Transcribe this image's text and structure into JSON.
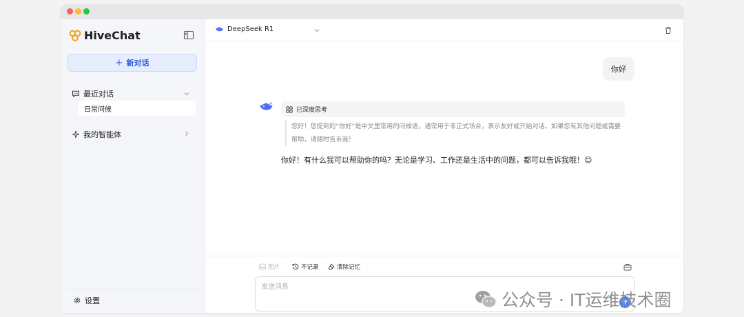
{
  "app": {
    "name": "HiveChat"
  },
  "sidebar": {
    "new_chat_label": "新对话",
    "recent_label": "最近对话",
    "recent_items": [
      "日常问候"
    ],
    "agents_label": "我的智能体",
    "settings_label": "设置"
  },
  "header": {
    "model_name": "DeepSeek R1"
  },
  "conversation": {
    "user_message": "你好",
    "thinking_label": "已深度思考",
    "thinking_text": "您好！您提到的“你好”是中文里常用的问候语，通常用于非正式场合，表示友好或开始对话。如果您有其他问题或需要帮助，请随时告诉我！",
    "answer_text": "你好！有什么我可以帮助你的吗？无论是学习、工作还是生活中的问题，都可以告诉我哦！😊"
  },
  "composer": {
    "image_label": "图片",
    "no_record_label": "不记录",
    "clear_memory_label": "清除记忆",
    "placeholder": "发送消息"
  },
  "watermark": {
    "text": "公众号 · IT运维技术圈"
  },
  "colors": {
    "accent": "#2f5fd8",
    "accent_bg": "#e6edfc",
    "send_button": "#4a7ff5",
    "logo": "#f5a623"
  },
  "icons": {
    "logo": "honeycomb-logo-icon",
    "sidebar_toggle": "sidebar-toggle-icon",
    "recent": "chat-bubble-icon",
    "agents": "sparkle-icon",
    "settings": "gear-icon",
    "model": "whale-icon",
    "delete": "trash-icon",
    "image": "image-icon",
    "no_record": "history-icon",
    "clear_memory": "eraser-icon",
    "send": "arrow-up-icon"
  }
}
